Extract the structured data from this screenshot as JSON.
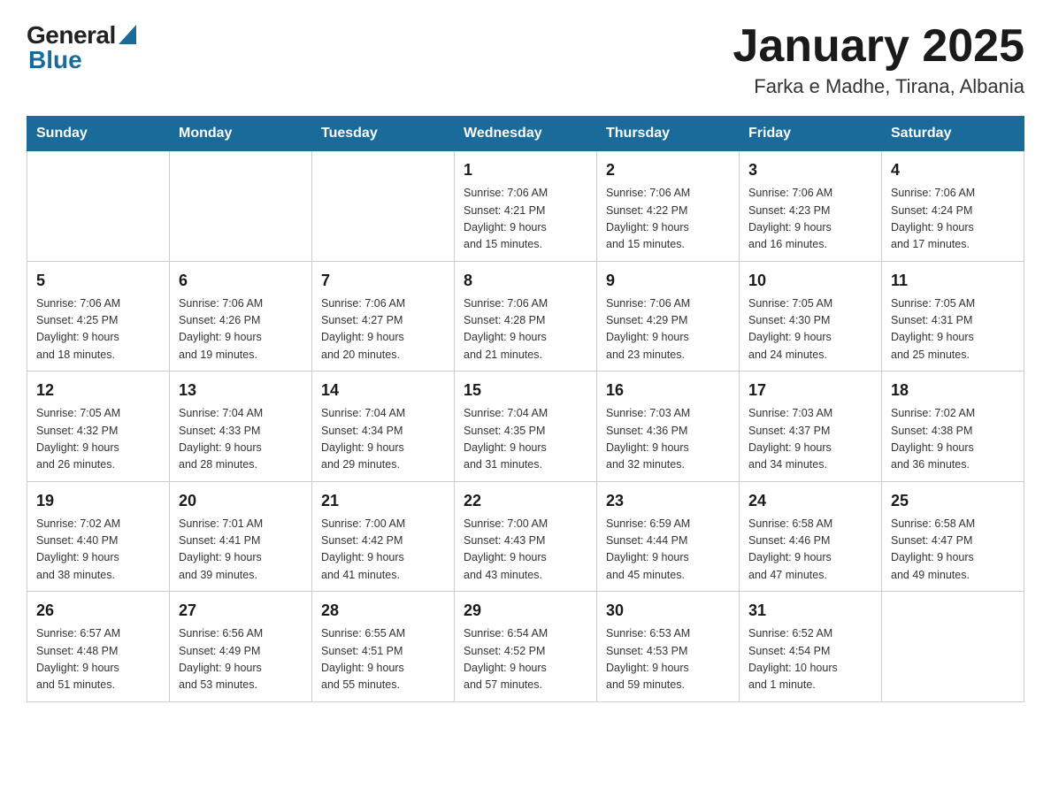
{
  "header": {
    "title": "January 2025",
    "subtitle": "Farka e Madhe, Tirana, Albania",
    "logo_general": "General",
    "logo_blue": "Blue"
  },
  "days_of_week": [
    "Sunday",
    "Monday",
    "Tuesday",
    "Wednesday",
    "Thursday",
    "Friday",
    "Saturday"
  ],
  "weeks": [
    {
      "days": [
        {
          "number": "",
          "info": ""
        },
        {
          "number": "",
          "info": ""
        },
        {
          "number": "",
          "info": ""
        },
        {
          "number": "1",
          "info": "Sunrise: 7:06 AM\nSunset: 4:21 PM\nDaylight: 9 hours\nand 15 minutes."
        },
        {
          "number": "2",
          "info": "Sunrise: 7:06 AM\nSunset: 4:22 PM\nDaylight: 9 hours\nand 15 minutes."
        },
        {
          "number": "3",
          "info": "Sunrise: 7:06 AM\nSunset: 4:23 PM\nDaylight: 9 hours\nand 16 minutes."
        },
        {
          "number": "4",
          "info": "Sunrise: 7:06 AM\nSunset: 4:24 PM\nDaylight: 9 hours\nand 17 minutes."
        }
      ]
    },
    {
      "days": [
        {
          "number": "5",
          "info": "Sunrise: 7:06 AM\nSunset: 4:25 PM\nDaylight: 9 hours\nand 18 minutes."
        },
        {
          "number": "6",
          "info": "Sunrise: 7:06 AM\nSunset: 4:26 PM\nDaylight: 9 hours\nand 19 minutes."
        },
        {
          "number": "7",
          "info": "Sunrise: 7:06 AM\nSunset: 4:27 PM\nDaylight: 9 hours\nand 20 minutes."
        },
        {
          "number": "8",
          "info": "Sunrise: 7:06 AM\nSunset: 4:28 PM\nDaylight: 9 hours\nand 21 minutes."
        },
        {
          "number": "9",
          "info": "Sunrise: 7:06 AM\nSunset: 4:29 PM\nDaylight: 9 hours\nand 23 minutes."
        },
        {
          "number": "10",
          "info": "Sunrise: 7:05 AM\nSunset: 4:30 PM\nDaylight: 9 hours\nand 24 minutes."
        },
        {
          "number": "11",
          "info": "Sunrise: 7:05 AM\nSunset: 4:31 PM\nDaylight: 9 hours\nand 25 minutes."
        }
      ]
    },
    {
      "days": [
        {
          "number": "12",
          "info": "Sunrise: 7:05 AM\nSunset: 4:32 PM\nDaylight: 9 hours\nand 26 minutes."
        },
        {
          "number": "13",
          "info": "Sunrise: 7:04 AM\nSunset: 4:33 PM\nDaylight: 9 hours\nand 28 minutes."
        },
        {
          "number": "14",
          "info": "Sunrise: 7:04 AM\nSunset: 4:34 PM\nDaylight: 9 hours\nand 29 minutes."
        },
        {
          "number": "15",
          "info": "Sunrise: 7:04 AM\nSunset: 4:35 PM\nDaylight: 9 hours\nand 31 minutes."
        },
        {
          "number": "16",
          "info": "Sunrise: 7:03 AM\nSunset: 4:36 PM\nDaylight: 9 hours\nand 32 minutes."
        },
        {
          "number": "17",
          "info": "Sunrise: 7:03 AM\nSunset: 4:37 PM\nDaylight: 9 hours\nand 34 minutes."
        },
        {
          "number": "18",
          "info": "Sunrise: 7:02 AM\nSunset: 4:38 PM\nDaylight: 9 hours\nand 36 minutes."
        }
      ]
    },
    {
      "days": [
        {
          "number": "19",
          "info": "Sunrise: 7:02 AM\nSunset: 4:40 PM\nDaylight: 9 hours\nand 38 minutes."
        },
        {
          "number": "20",
          "info": "Sunrise: 7:01 AM\nSunset: 4:41 PM\nDaylight: 9 hours\nand 39 minutes."
        },
        {
          "number": "21",
          "info": "Sunrise: 7:00 AM\nSunset: 4:42 PM\nDaylight: 9 hours\nand 41 minutes."
        },
        {
          "number": "22",
          "info": "Sunrise: 7:00 AM\nSunset: 4:43 PM\nDaylight: 9 hours\nand 43 minutes."
        },
        {
          "number": "23",
          "info": "Sunrise: 6:59 AM\nSunset: 4:44 PM\nDaylight: 9 hours\nand 45 minutes."
        },
        {
          "number": "24",
          "info": "Sunrise: 6:58 AM\nSunset: 4:46 PM\nDaylight: 9 hours\nand 47 minutes."
        },
        {
          "number": "25",
          "info": "Sunrise: 6:58 AM\nSunset: 4:47 PM\nDaylight: 9 hours\nand 49 minutes."
        }
      ]
    },
    {
      "days": [
        {
          "number": "26",
          "info": "Sunrise: 6:57 AM\nSunset: 4:48 PM\nDaylight: 9 hours\nand 51 minutes."
        },
        {
          "number": "27",
          "info": "Sunrise: 6:56 AM\nSunset: 4:49 PM\nDaylight: 9 hours\nand 53 minutes."
        },
        {
          "number": "28",
          "info": "Sunrise: 6:55 AM\nSunset: 4:51 PM\nDaylight: 9 hours\nand 55 minutes."
        },
        {
          "number": "29",
          "info": "Sunrise: 6:54 AM\nSunset: 4:52 PM\nDaylight: 9 hours\nand 57 minutes."
        },
        {
          "number": "30",
          "info": "Sunrise: 6:53 AM\nSunset: 4:53 PM\nDaylight: 9 hours\nand 59 minutes."
        },
        {
          "number": "31",
          "info": "Sunrise: 6:52 AM\nSunset: 4:54 PM\nDaylight: 10 hours\nand 1 minute."
        },
        {
          "number": "",
          "info": ""
        }
      ]
    }
  ]
}
